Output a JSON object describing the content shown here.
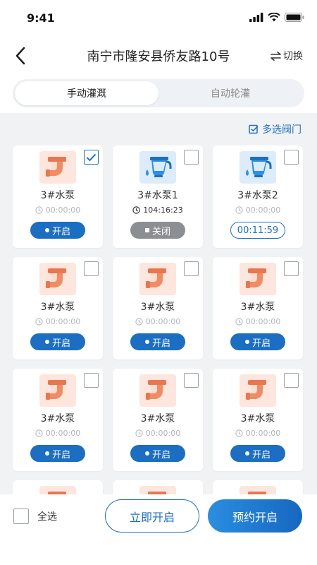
{
  "status_bar": {
    "time": "9:41"
  },
  "nav": {
    "title": "南宁市隆安县侨友路10号",
    "switch_label": "切换"
  },
  "tabs": [
    {
      "label": "手动灌溉",
      "active": true
    },
    {
      "label": "自动轮灌",
      "active": false
    }
  ],
  "multi_select_label": "多选阀门",
  "devices": [
    {
      "name": "3#水泵",
      "icon": "pipe-icon",
      "time": "00:00:00",
      "status": "开启",
      "status_type": "on",
      "checked": true
    },
    {
      "name": "3#水泵1",
      "icon": "pump-icon",
      "time": "104:16:23",
      "status": "关闭",
      "status_type": "off",
      "checked": false
    },
    {
      "name": "3#水泵2",
      "icon": "pump-icon",
      "time": "00:00:00",
      "status": "00:11:59",
      "status_type": "timer",
      "checked": false
    },
    {
      "name": "3#水泵",
      "icon": "pipe-icon",
      "time": "00:00:00",
      "status": "开启",
      "status_type": "on",
      "checked": false
    },
    {
      "name": "3#水泵",
      "icon": "pipe-icon",
      "time": "00:00:00",
      "status": "开启",
      "status_type": "on",
      "checked": false
    },
    {
      "name": "3#水泵",
      "icon": "pipe-icon",
      "time": "00:00:00",
      "status": "开启",
      "status_type": "on",
      "checked": false
    },
    {
      "name": "3#水泵",
      "icon": "pipe-icon",
      "time": "00:00:00",
      "status": "开启",
      "status_type": "on",
      "checked": false
    },
    {
      "name": "3#水泵",
      "icon": "pipe-icon",
      "time": "00:00:00",
      "status": "开启",
      "status_type": "on",
      "checked": false
    },
    {
      "name": "3#水泵",
      "icon": "pipe-icon",
      "time": "00:00:00",
      "status": "开启",
      "status_type": "on",
      "checked": false
    },
    {
      "name": "",
      "icon": "pipe-icon",
      "time": "",
      "status": "",
      "status_type": "partial",
      "checked": false
    },
    {
      "name": "",
      "icon": "pipe-icon",
      "time": "",
      "status": "",
      "status_type": "partial",
      "checked": false
    },
    {
      "name": "",
      "icon": "pipe-icon",
      "time": "",
      "status": "",
      "status_type": "partial",
      "checked": false
    }
  ],
  "bottom": {
    "select_all_label": "全选",
    "start_now_label": "立即开启",
    "schedule_label": "预约开启"
  },
  "colors": {
    "primary": "#1b6ec2",
    "pipe_bg": "#fde6dd",
    "pump_bg": "#dcecfb",
    "off": "#8b8f94"
  }
}
